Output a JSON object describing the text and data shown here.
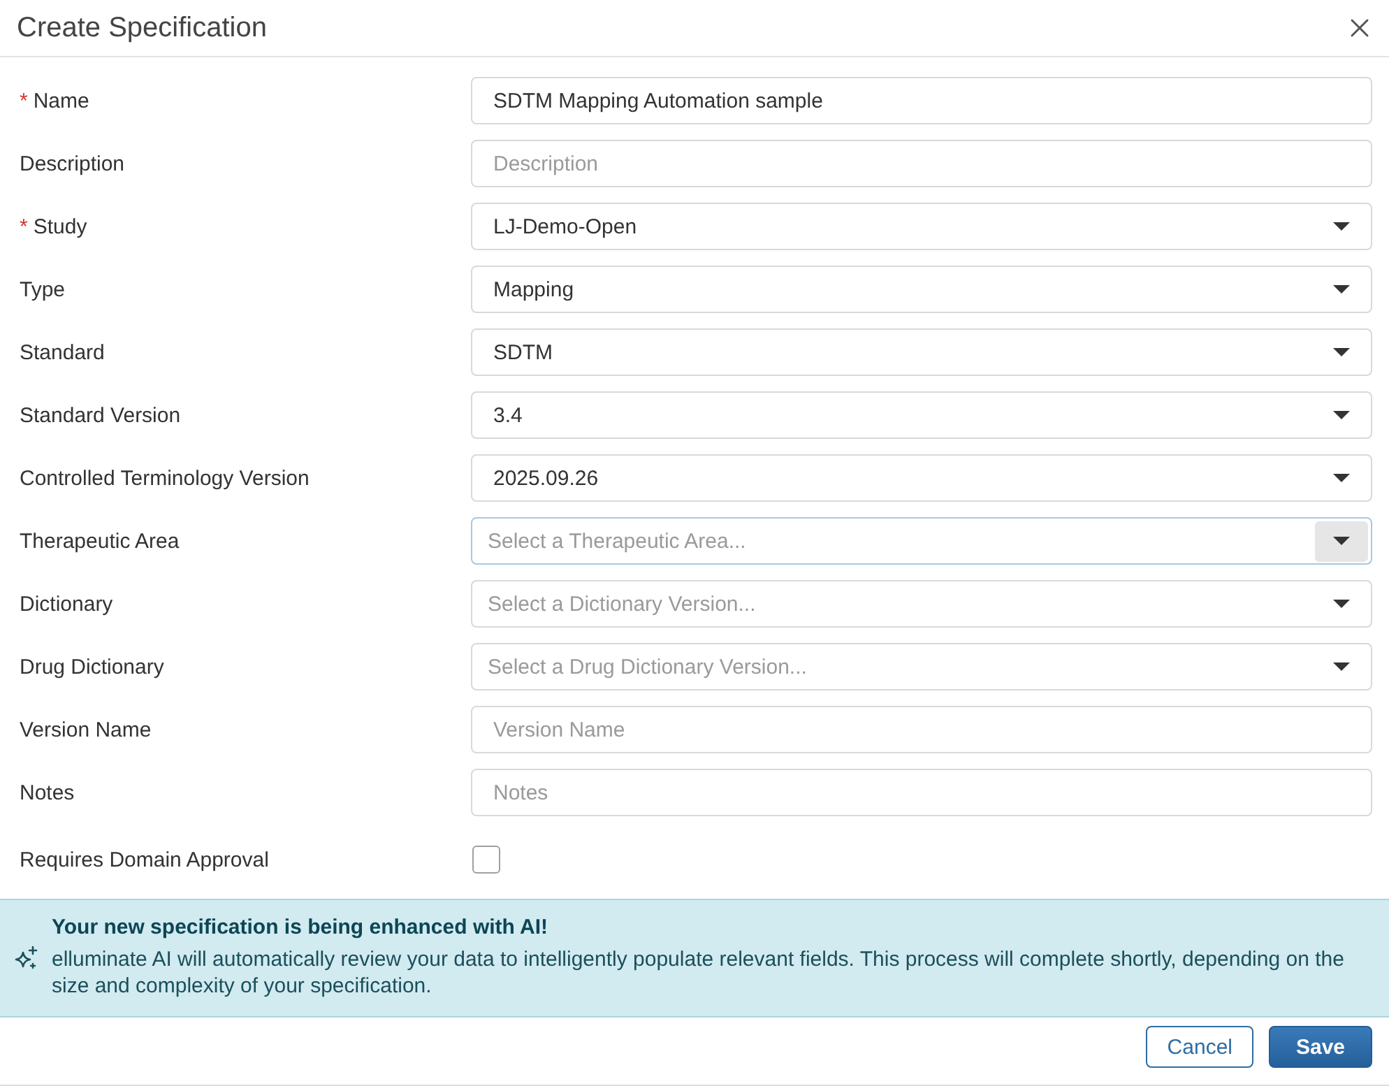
{
  "dialog": {
    "title": "Create Specification"
  },
  "fields": [
    {
      "kind": "text",
      "label": "Name",
      "marker": "*",
      "focused": false,
      "value": "SDTM Mapping Automation sample"
    },
    {
      "kind": "text",
      "label": "Description",
      "focused": false,
      "placeholder": "Description"
    },
    {
      "kind": "select",
      "label": "Study",
      "marker": "*",
      "focused": false,
      "value": "LJ-Demo-Open"
    },
    {
      "kind": "select",
      "label": "Type",
      "focused": false,
      "value": "Mapping"
    },
    {
      "kind": "select",
      "label": "Standard",
      "focused": false,
      "value": "SDTM"
    },
    {
      "kind": "select",
      "label": "Standard Version",
      "focused": false,
      "value": "3.4"
    },
    {
      "kind": "select",
      "label": "Controlled Terminology Version",
      "focused": false,
      "value": "2025.09.26"
    },
    {
      "kind": "select",
      "label": "Therapeutic Area",
      "focused": true,
      "placeholder": "Select a Therapeutic Area..."
    },
    {
      "kind": "select",
      "label": "Dictionary",
      "focused": false,
      "placeholder": "Select a Dictionary Version..."
    },
    {
      "kind": "select",
      "label": "Drug Dictionary",
      "focused": false,
      "placeholder": "Select a Drug Dictionary Version..."
    },
    {
      "kind": "text",
      "label": "Version Name",
      "focused": false,
      "placeholder": "Version Name"
    },
    {
      "kind": "text",
      "label": "Notes",
      "focused": false,
      "placeholder": "Notes"
    },
    {
      "kind": "checkbox",
      "label": "Requires Domain Approval",
      "checked": false
    }
  ],
  "notice": {
    "title": "Your new specification is being enhanced with AI!",
    "body": "elluminate AI will automatically review your data to intelligently populate relevant fields. This process will complete shortly, depending on the size and complexity of your specification."
  },
  "buttons": [
    {
      "kind": "secondary",
      "label": "Cancel"
    },
    {
      "kind": "primary",
      "label": "Save"
    }
  ]
}
